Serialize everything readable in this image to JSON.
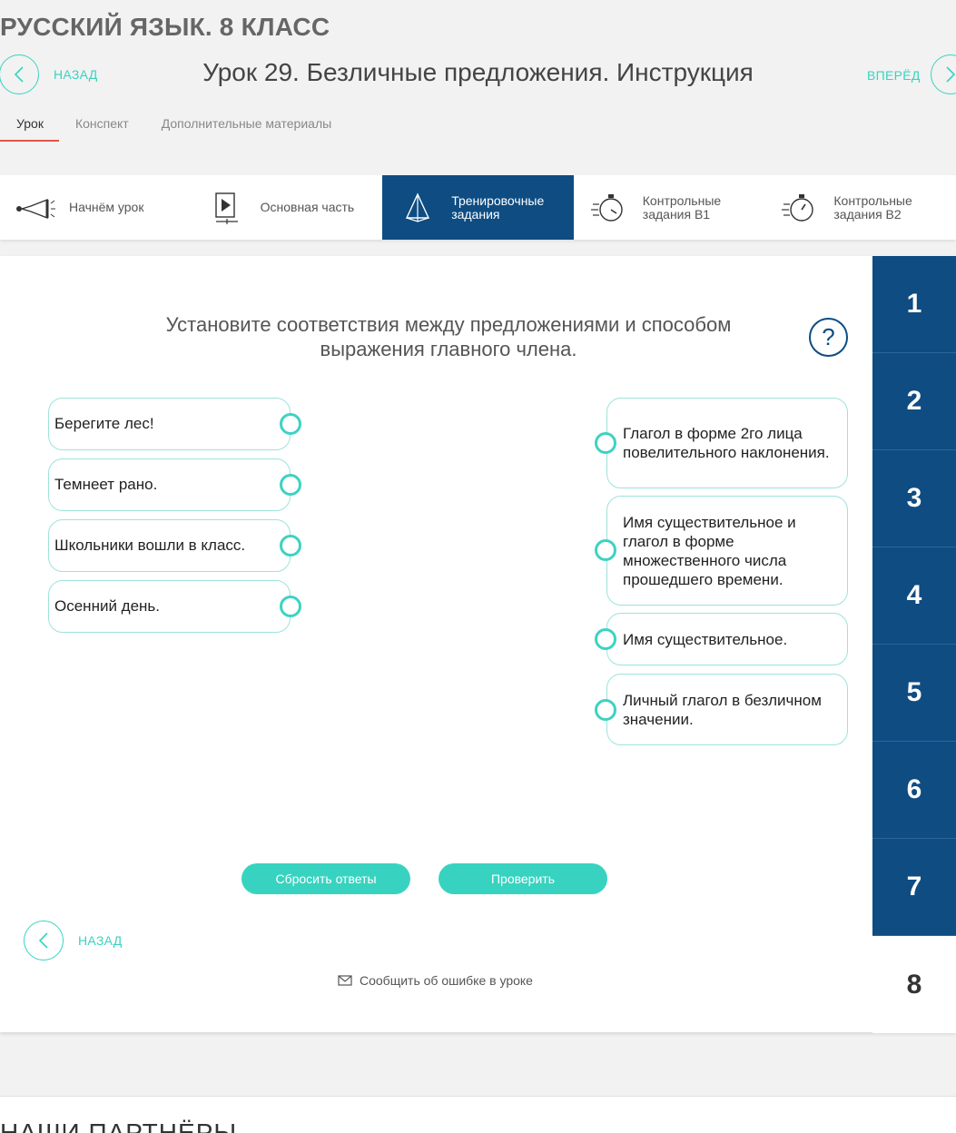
{
  "course": {
    "title": "РУССКИЙ ЯЗЫК. 8 КЛАСС"
  },
  "nav": {
    "back_label": "НАЗАД",
    "forward_label": "ВПЕРЁД",
    "lesson_title": "Урок 29. Безличные предложения. Инструкция"
  },
  "tabs": [
    {
      "label": "Урок",
      "active": true
    },
    {
      "label": "Конспект",
      "active": false
    },
    {
      "label": "Дополнительные материалы",
      "active": false
    }
  ],
  "steps": [
    {
      "line1": "Начнём урок",
      "line2": "",
      "icon": "megaphone-icon"
    },
    {
      "line1": "Основная часть",
      "line2": "",
      "icon": "play-icon"
    },
    {
      "line1": "Тренировочные",
      "line2": "задания",
      "icon": "pyramid-icon",
      "active": true
    },
    {
      "line1": "Контрольные",
      "line2": "задания В1",
      "icon": "stopwatch-icon"
    },
    {
      "line1": "Контрольные",
      "line2": "задания В2",
      "icon": "stopwatch-icon"
    }
  ],
  "task": {
    "question": "Установите соответствия между предложениями и способом выражения главного члена.",
    "left_items": [
      "Берегите лес!",
      "Темнеет рано.",
      "Школьники вошли в класс.",
      "Осенний день."
    ],
    "right_items": [
      "Глагол в форме 2го лица повелительного наклонения.",
      "Имя существительное и глагол в форме множественного числа прошедшего времени.",
      "Имя существительное.",
      "Личный глагол в безличном значении."
    ],
    "reset_label": "Сбросить ответы",
    "check_label": "Проверить"
  },
  "task_numbers": [
    "1",
    "2",
    "3",
    "4",
    "5",
    "6",
    "7",
    "8"
  ],
  "footer": {
    "back_label": "НАЗАД",
    "report_label": "Сообщить об ошибке в уроке"
  },
  "partners_title": "НАШИ ПАРТНЁРЫ",
  "colors": {
    "accent": "#38d3c0",
    "primary": "#0e4c82",
    "tab_underline": "#e5534b"
  }
}
